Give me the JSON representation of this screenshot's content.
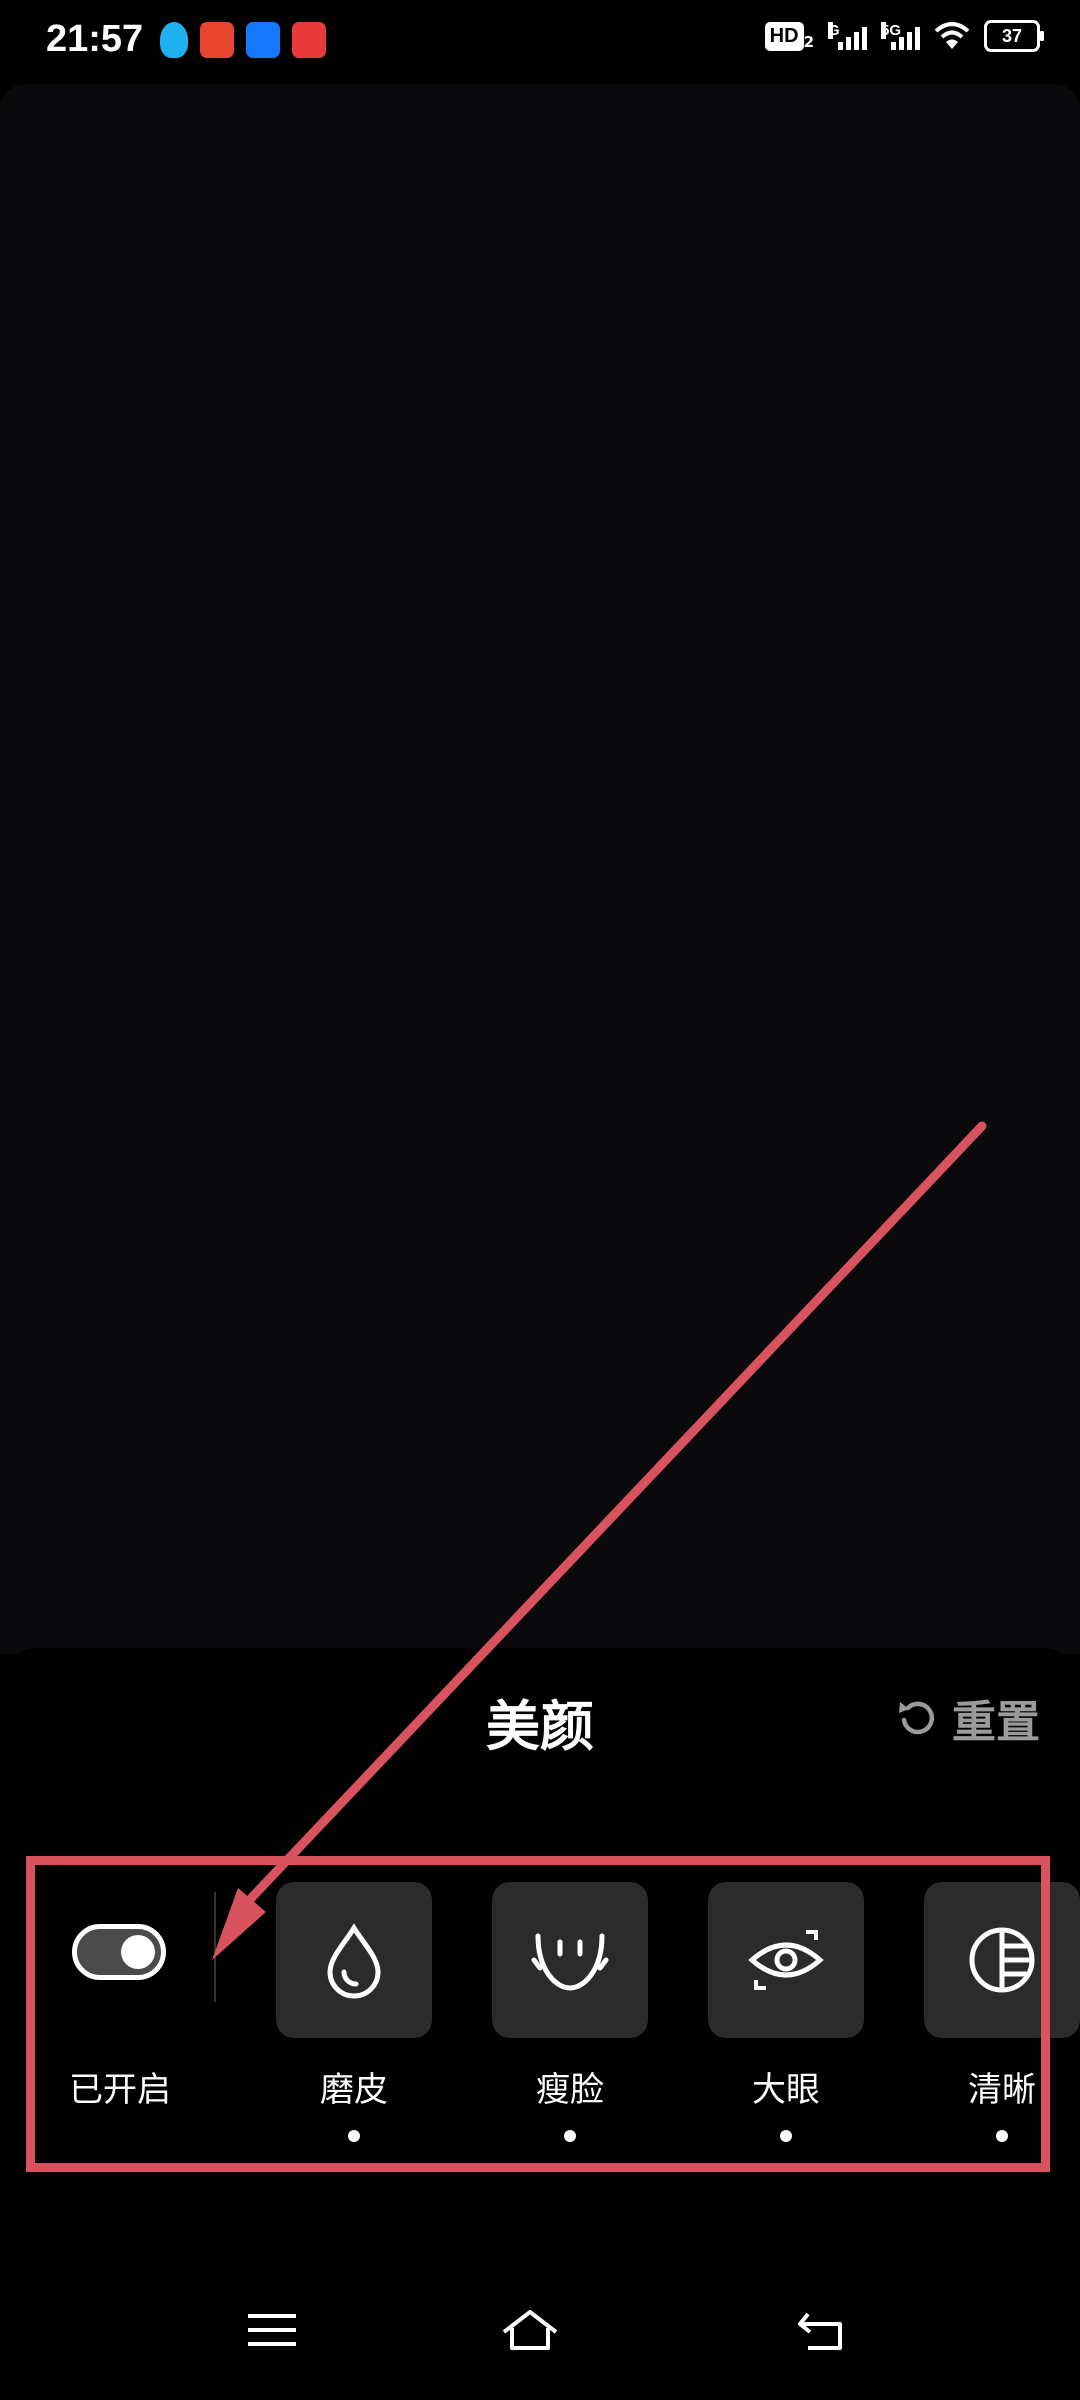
{
  "status_bar": {
    "time": "21:57",
    "notification_icons": [
      "qq-icon",
      "taobao-icon",
      "robot-app-icon",
      "shopping-app-icon"
    ],
    "hd_label": "HD",
    "hd_sub": "2",
    "signal1_label": "G",
    "signal2_label": "5G",
    "battery": "37"
  },
  "sheet": {
    "title": "美颜",
    "reset_label": "重置",
    "toggle": {
      "label": "已开启",
      "on": true
    },
    "effects": [
      {
        "label": "磨皮",
        "icon": "droplet-icon"
      },
      {
        "label": "瘦脸",
        "icon": "face-slim-icon"
      },
      {
        "label": "大眼",
        "icon": "eye-icon"
      },
      {
        "label": "清晰",
        "icon": "clarity-icon"
      }
    ]
  },
  "annotation": {
    "color": "#d9535e"
  },
  "navbar": [
    "menu-icon",
    "home-icon",
    "back-icon"
  ]
}
